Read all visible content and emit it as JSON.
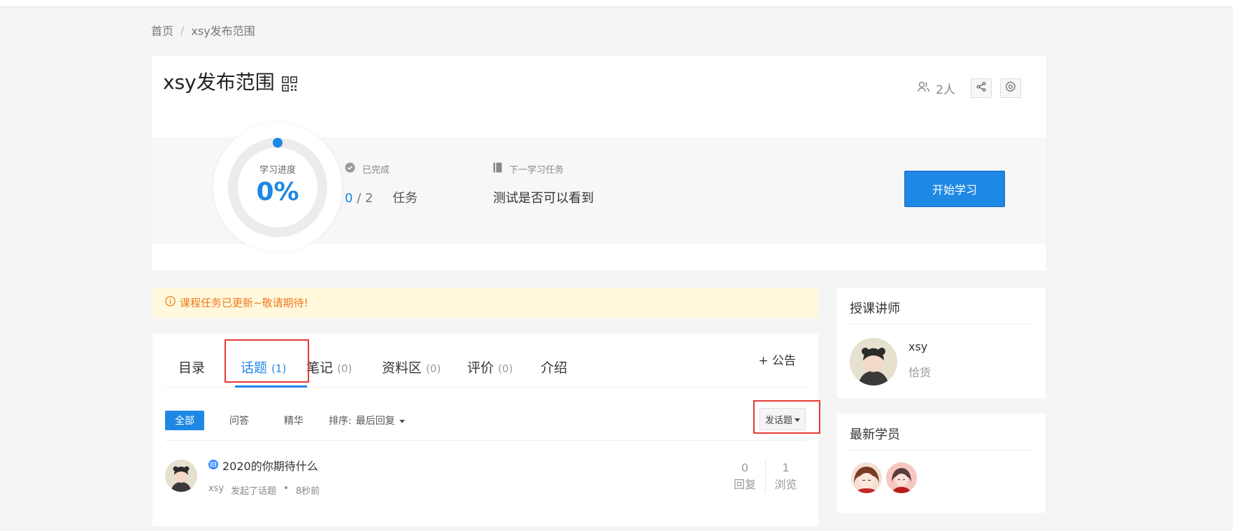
{
  "breadcrumb": {
    "home": "首页",
    "separator": "/",
    "current": "xsy发布范围"
  },
  "course": {
    "title": "xsy发布范围",
    "members": "2人",
    "progress": {
      "label": "学习进度",
      "value_text": "0%",
      "value": 0
    },
    "completed": {
      "label": "已完成",
      "done": "0",
      "slash": "/",
      "total": "2",
      "unit": "任务"
    },
    "next_task": {
      "label": "下一学习任务",
      "name": "测试是否可以看到"
    },
    "start_button": "开始学习"
  },
  "notice": {
    "text": "课程任务已更新~敬请期待!"
  },
  "tabs": {
    "items": [
      {
        "label": "目录",
        "count": ""
      },
      {
        "label": "话题",
        "count": "(1)"
      },
      {
        "label": "笔记",
        "count": "(0)"
      },
      {
        "label": "资料区",
        "count": "(0)"
      },
      {
        "label": "评价",
        "count": "(0)"
      },
      {
        "label": "介绍",
        "count": ""
      }
    ],
    "active": "话题",
    "announcement": "+ 公告"
  },
  "filters": {
    "items": [
      "全部",
      "问答",
      "精华"
    ],
    "active": "全部",
    "sort_label": "排序:",
    "sort_value": "最后回复",
    "post_button": "发话题"
  },
  "topics": [
    {
      "title": "2020的你期待什么",
      "author": "xsy",
      "action": "发起了话题",
      "dot": "•",
      "time": "8秒前",
      "replies": "0",
      "replies_label": "回复",
      "views": "1",
      "views_label": "浏览"
    }
  ],
  "sidebar": {
    "teacher": {
      "title": "授课讲师",
      "name": "xsy",
      "role": "恰货"
    },
    "students": {
      "title": "最新学员",
      "count": 2
    }
  },
  "colors": {
    "accent": "#1e88e5",
    "notice_bg": "#fff8dc",
    "notice_text": "#f07a1e",
    "highlight": "#e53935"
  }
}
